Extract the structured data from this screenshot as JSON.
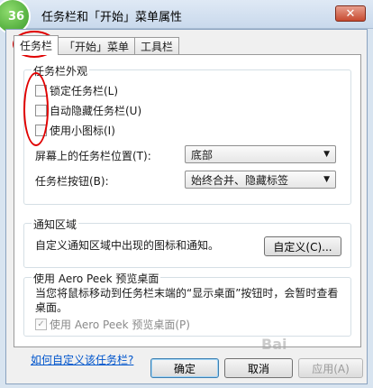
{
  "window": {
    "title": "任务栏和「开始」菜单属性",
    "close_symbol": "✕",
    "badge_number": "36"
  },
  "tabs": [
    {
      "label": "任务栏",
      "active": true
    },
    {
      "label": "「开始」菜单",
      "active": false
    },
    {
      "label": "工具栏",
      "active": false
    }
  ],
  "appearance": {
    "legend": "任务栏外观",
    "lock_label": "锁定任务栏(L)",
    "autohide_label": "自动隐藏任务栏(U)",
    "small_icons_label": "使用小图标(I)",
    "location_label": "屏幕上的任务栏位置(T):",
    "location_value": "底部",
    "buttons_label": "任务栏按钮(B):",
    "buttons_value": "始终合并、隐藏标签"
  },
  "notify": {
    "legend": "通知区域",
    "description": "自定义通知区域中出现的图标和通知。",
    "customize_button": "自定义(C)..."
  },
  "aero": {
    "legend": "使用 Aero Peek 预览桌面",
    "description": "当您将鼠标移动到任务栏末端的“显示桌面”按钮时，会暂时查看桌面。",
    "checkbox_label": "使用 Aero Peek 预览桌面(P)",
    "checked": true
  },
  "help_link": "如何自定义该任务栏?",
  "footer": {
    "ok": "确定",
    "cancel": "取消",
    "apply": "应用(A)"
  },
  "watermark": "Bai"
}
